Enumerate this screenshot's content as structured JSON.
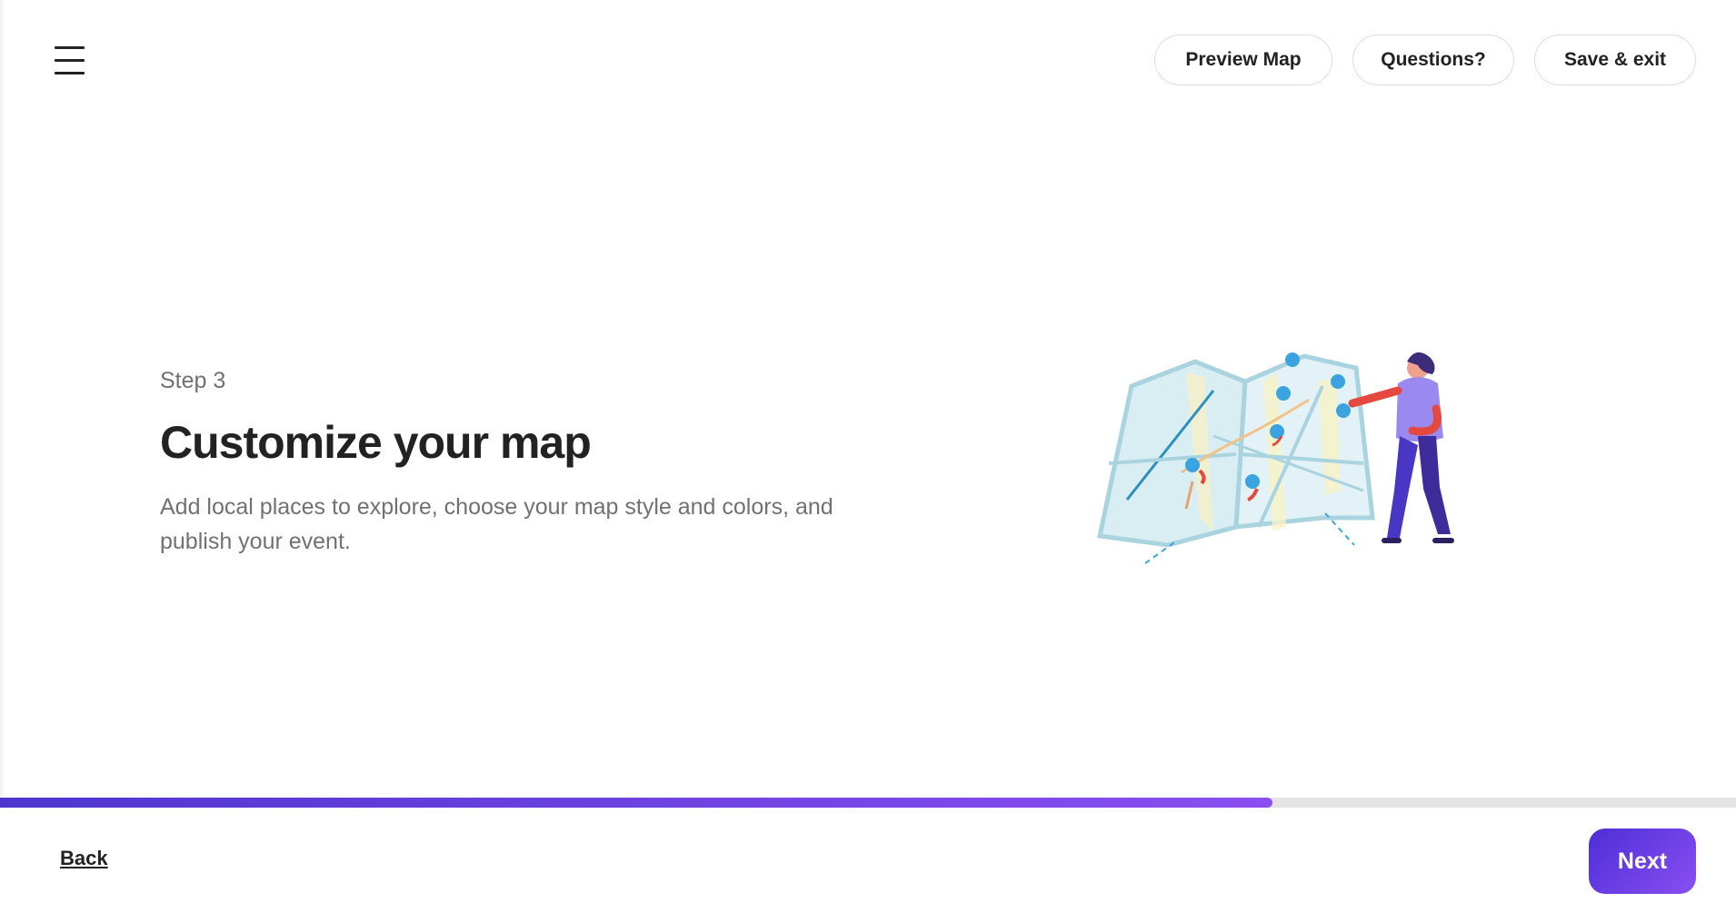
{
  "header": {
    "menu_icon": "hamburger-menu-icon",
    "actions": {
      "preview_label": "Preview Map",
      "questions_label": "Questions?",
      "save_exit_label": "Save & exit"
    }
  },
  "main": {
    "step_label": "Step 3",
    "title": "Customize your map",
    "description": "Add local places to explore, choose your map style and colors, and publish your event.",
    "illustration_icon": "map-person-illustration"
  },
  "progress": {
    "fraction": 0.733
  },
  "footer": {
    "back_label": "Back",
    "next_label": "Next"
  },
  "colors": {
    "accent_start": "#4f35cf",
    "accent_end": "#8b4ff0",
    "text_primary": "#222222",
    "text_secondary": "#717171"
  }
}
